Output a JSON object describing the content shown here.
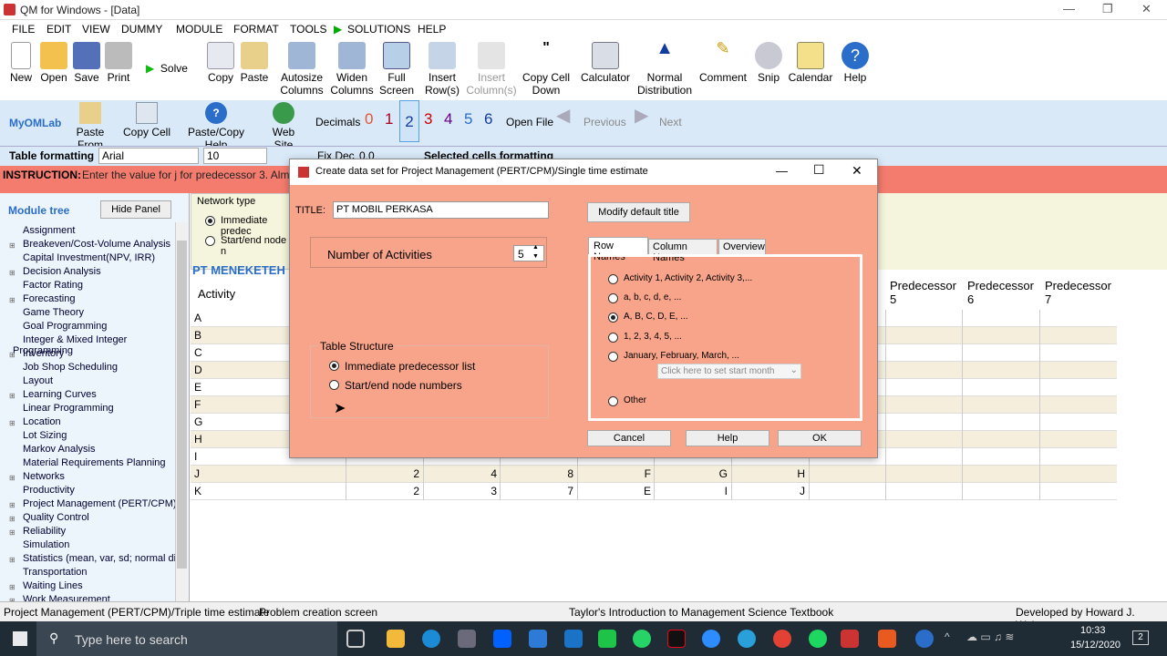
{
  "window": {
    "title": "QM for Windows - [Data]",
    "minimize": "—",
    "restore": "❐",
    "close": "✕"
  },
  "menu": [
    "FILE",
    "EDIT",
    "VIEW",
    "DUMMY",
    "MODULE",
    "FORMAT",
    "TOOLS",
    "SOLUTIONS",
    "HELP"
  ],
  "toolbar1": [
    {
      "label": "New",
      "sub": ""
    },
    {
      "label": "Open",
      "sub": ""
    },
    {
      "label": "Save",
      "sub": ""
    },
    {
      "label": "Print",
      "sub": ""
    },
    {
      "label": "Solve",
      "sub": ""
    },
    {
      "label": "Copy",
      "sub": ""
    },
    {
      "label": "Paste",
      "sub": ""
    },
    {
      "label": "Autosize",
      "sub": "Columns"
    },
    {
      "label": "Widen",
      "sub": "Columns"
    },
    {
      "label": "Full",
      "sub": "Screen"
    },
    {
      "label": "Insert",
      "sub": "Row(s)"
    },
    {
      "label": "Insert",
      "sub": "Column(s)"
    },
    {
      "label": "Copy Cell",
      "sub": "Down"
    },
    {
      "label": "Calculator",
      "sub": ""
    },
    {
      "label": "Normal",
      "sub": "Distribution"
    },
    {
      "label": "Comment",
      "sub": ""
    },
    {
      "label": "Snip",
      "sub": ""
    },
    {
      "label": "Calendar",
      "sub": ""
    },
    {
      "label": "Help",
      "sub": ""
    }
  ],
  "toolbar2": {
    "myomlab": "MyOMLab",
    "paste_from": "Paste From",
    "copy_cell": "Copy Cell",
    "paste_copy_help": "Paste/Copy Help",
    "web_site": "Web Site",
    "decimals_label": "Decimals",
    "decimals": [
      "0",
      "1",
      "2",
      "3",
      "4",
      "5",
      "6"
    ],
    "open_file": "Open File",
    "previous": "Previous",
    "next": "Next",
    "myom": "MyOM"
  },
  "format": {
    "label": "Table formatting",
    "font": "Arial",
    "size": "10",
    "fix_dec": "Fix Dec",
    "zero": "0.0",
    "selected": "Selected cells formatting"
  },
  "instruction": {
    "label": "INSTRUCTION:",
    "text": "Enter the value for j for predecessor 3. Almo"
  },
  "left_panel": {
    "title": "Module tree",
    "hide": "Hide Panel",
    "items": [
      {
        "t": "Assignment",
        "p": false
      },
      {
        "t": "Breakeven/Cost-Volume Analysis",
        "p": true
      },
      {
        "t": "Capital Investment(NPV, IRR)",
        "p": false
      },
      {
        "t": "Decision Analysis",
        "p": true
      },
      {
        "t": "Factor Rating",
        "p": false
      },
      {
        "t": "Forecasting",
        "p": true
      },
      {
        "t": "Game Theory",
        "p": false
      },
      {
        "t": "Goal Programming",
        "p": false
      },
      {
        "t": "Integer & Mixed Integer Programming",
        "p": false
      },
      {
        "t": "Inventory",
        "p": true
      },
      {
        "t": "Job Shop Scheduling",
        "p": false
      },
      {
        "t": "Layout",
        "p": false
      },
      {
        "t": "Learning Curves",
        "p": true
      },
      {
        "t": "Linear Programming",
        "p": false
      },
      {
        "t": "Location",
        "p": true
      },
      {
        "t": "Lot Sizing",
        "p": false
      },
      {
        "t": "Markov Analysis",
        "p": false
      },
      {
        "t": "Material Requirements Planning",
        "p": false
      },
      {
        "t": "Networks",
        "p": true
      },
      {
        "t": "Productivity",
        "p": false
      },
      {
        "t": "Project Management (PERT/CPM)",
        "p": true
      },
      {
        "t": "Quality Control",
        "p": true
      },
      {
        "t": "Reliability",
        "p": true
      },
      {
        "t": "Simulation",
        "p": false
      },
      {
        "t": "Statistics (mean, var, sd; normal dist)",
        "p": true
      },
      {
        "t": "Transportation",
        "p": false
      },
      {
        "t": "Waiting Lines",
        "p": true
      },
      {
        "t": "Work Measurement",
        "p": true
      }
    ]
  },
  "network_type": {
    "title": "Network type",
    "opt1": "Immediate predec",
    "opt2": "Start/end node n"
  },
  "grid": {
    "title": "PT MENEKETEH",
    "activity_header": "Activity",
    "pred_headers": [
      {
        "a": "Predecessor",
        "b": "5"
      },
      {
        "a": "Predecessor",
        "b": "6"
      },
      {
        "a": "Predecessor",
        "b": "7"
      }
    ],
    "rows": [
      {
        "n": "A",
        "v": []
      },
      {
        "n": "B",
        "v": []
      },
      {
        "n": "C",
        "v": []
      },
      {
        "n": "D",
        "v": []
      },
      {
        "n": "E",
        "v": []
      },
      {
        "n": "F",
        "v": []
      },
      {
        "n": "G",
        "v": []
      },
      {
        "n": "H",
        "v": []
      },
      {
        "n": "I",
        "v": []
      },
      {
        "n": "J",
        "v": [
          "2",
          "4",
          "8",
          "F",
          "G",
          "H"
        ]
      },
      {
        "n": "K",
        "v": [
          "2",
          "3",
          "7",
          "E",
          "I",
          "J"
        ]
      }
    ]
  },
  "dialog": {
    "title": "Create data set for Project Management (PERT/CPM)/Single time estimate",
    "title_label": "TITLE:",
    "title_value": "PT MOBIL PERKASA",
    "modify": "Modify default title",
    "num_label": "Number of Activities",
    "num_value": "5",
    "table_structure": "Table Structure",
    "ts_opt1": "Immediate predecessor list",
    "ts_opt2": "Start/end node numbers",
    "tabs": [
      "Row Names",
      "Column Names",
      "Overview"
    ],
    "row_opts": [
      "Activity 1, Activity 2, Activity 3,...",
      "a, b, c, d, e, ...",
      "A, B, C, D, E, ...",
      "1, 2, 3, 4, 5, ...",
      "January, February, March, ...",
      "Other"
    ],
    "month_placeholder": "Click here to set start month",
    "cancel": "Cancel",
    "help": "Help",
    "ok": "OK"
  },
  "status": {
    "s1": "Project Management (PERT/CPM)/Triple time estimate",
    "s2": "Problem creation screen",
    "s3": "Taylor's Introduction to Management Science Textbook",
    "s4": "Developed by Howard J. Weiss"
  },
  "taskbar": {
    "search": "Type here to search",
    "time": "10:33",
    "date": "15/12/2020",
    "notif": "2"
  }
}
